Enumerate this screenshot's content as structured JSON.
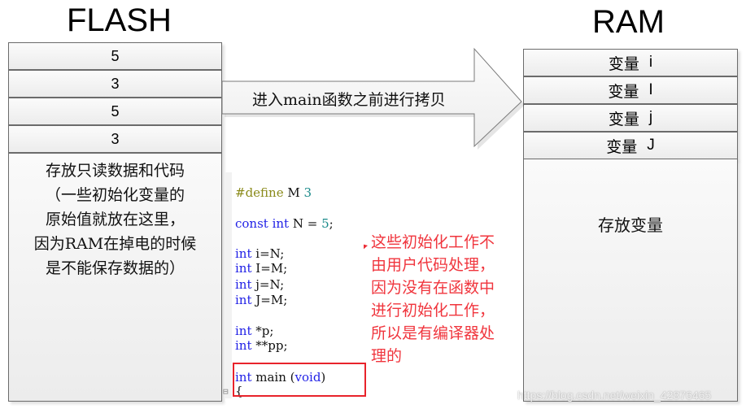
{
  "flash": {
    "title": "FLASH",
    "cells": [
      "5",
      "3",
      "5",
      "3"
    ],
    "description": "存放只读数据和代码\n（一些初始化变量的\n原始值就放在这里，\n因为RAM在掉电的时候\n是不能保存数据的）"
  },
  "ram": {
    "title": "RAM",
    "cells": [
      {
        "label": "变量",
        "var": "i"
      },
      {
        "label": "变量",
        "var": "I"
      },
      {
        "label": "变量",
        "var": "j"
      },
      {
        "label": "变量",
        "var": "J"
      }
    ],
    "description": "存放变量"
  },
  "arrow": {
    "label": "进入main函数之前进行拷贝"
  },
  "code": {
    "lines": [
      {
        "parts": [
          {
            "t": "#define ",
            "c": "pp"
          },
          {
            "t": "M ",
            "c": ""
          },
          {
            "t": "3",
            "c": "num"
          }
        ]
      },
      {
        "parts": [
          {
            "t": "const int ",
            "c": "kw"
          },
          {
            "t": "N = ",
            "c": ""
          },
          {
            "t": "5",
            "c": "num"
          },
          {
            "t": ";",
            "c": ""
          }
        ]
      },
      {
        "parts": [
          {
            "t": "int ",
            "c": "kw"
          },
          {
            "t": "i=N;",
            "c": ""
          }
        ]
      },
      {
        "parts": [
          {
            "t": "int ",
            "c": "kw"
          },
          {
            "t": "I=M;",
            "c": ""
          }
        ]
      },
      {
        "parts": [
          {
            "t": "int ",
            "c": "kw"
          },
          {
            "t": "j=N;",
            "c": ""
          }
        ]
      },
      {
        "parts": [
          {
            "t": "int ",
            "c": "kw"
          },
          {
            "t": "J=M;",
            "c": ""
          }
        ]
      },
      {
        "parts": [
          {
            "t": "int ",
            "c": "kw"
          },
          {
            "t": "*p;",
            "c": ""
          }
        ]
      },
      {
        "parts": [
          {
            "t": "int ",
            "c": "kw"
          },
          {
            "t": "**pp;",
            "c": ""
          }
        ]
      },
      {
        "parts": [
          {
            "t": "int ",
            "c": "kw"
          },
          {
            "t": "main (",
            "c": ""
          },
          {
            "t": "void",
            "c": "kw"
          },
          {
            "t": ")",
            "c": ""
          }
        ]
      },
      {
        "parts": [
          {
            "t": "{",
            "c": ""
          }
        ]
      }
    ],
    "fold_icon": "⊟"
  },
  "annotation": {
    "text": "这些初始化工作不\n由用户代码处理，\n因为没有在函数中\n进行初始化工作，\n所以是有编译器处\n理的",
    "color": "#f0353d"
  },
  "highlight_color": "#e8232b",
  "watermark": "https://blog.csdn.net/weixin_42876465"
}
